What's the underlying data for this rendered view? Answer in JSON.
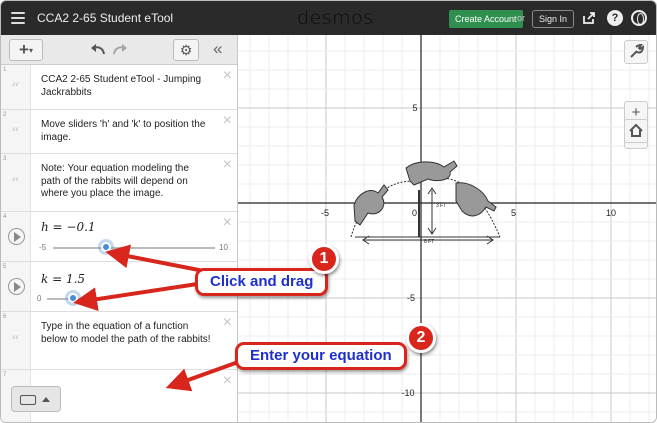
{
  "topbar": {
    "graph_title": "CCA2 2-65 Student eTool",
    "brand": "desmos",
    "create_account_label": "Create Account",
    "or_text": "or",
    "sign_in_label": "Sign In",
    "help_glyph": "?"
  },
  "toolbar": {
    "add_glyph": "+",
    "settings_glyph": "⚙",
    "collapse_glyph": "«"
  },
  "expressions": [
    {
      "num": "1",
      "type": "note",
      "text": "CCA2 2-65 Student eTool - Jumping Jackrabbits"
    },
    {
      "num": "2",
      "type": "note",
      "text": "Move sliders 'h' and 'k' to position the image."
    },
    {
      "num": "3",
      "type": "note",
      "text": "Note: Your equation modeling the path of the rabbits will depend on where you place the image."
    },
    {
      "num": "4",
      "type": "slider",
      "label": "h = −0.1",
      "min": "-5",
      "max": "10",
      "value": -0.1
    },
    {
      "num": "5",
      "type": "slider",
      "label": "k = 1.5",
      "min": "0",
      "max": "",
      "value": 1.5
    },
    {
      "num": "6",
      "type": "note",
      "text": "Type in the equation of a function below to model the path of the rabbits!"
    },
    {
      "num": "7",
      "type": "input",
      "text": ""
    }
  ],
  "graph": {
    "x_tick_labels": [
      "-5",
      "0",
      "5",
      "10"
    ],
    "y_tick_labels": [
      "5",
      "-5",
      "-10"
    ],
    "image_labels": [
      "3 FT",
      "8 FT"
    ],
    "zoom_in_glyph": "+",
    "zoom_out_glyph": "−"
  },
  "callouts": [
    {
      "badge": "1",
      "text": "Click and drag"
    },
    {
      "badge": "2",
      "text": "Enter your equation"
    }
  ],
  "colors": {
    "callout_border": "#d9261c",
    "callout_text": "#1e2fd0",
    "create_account": "#2f8f4e",
    "slider_thumb": "#4a8bd6"
  },
  "icons": [
    "hamburger-icon",
    "share-icon",
    "help-icon",
    "globe-icon",
    "undo-icon",
    "redo-icon",
    "gear-icon",
    "wrench-icon",
    "home-icon",
    "keyboard-icon"
  ]
}
